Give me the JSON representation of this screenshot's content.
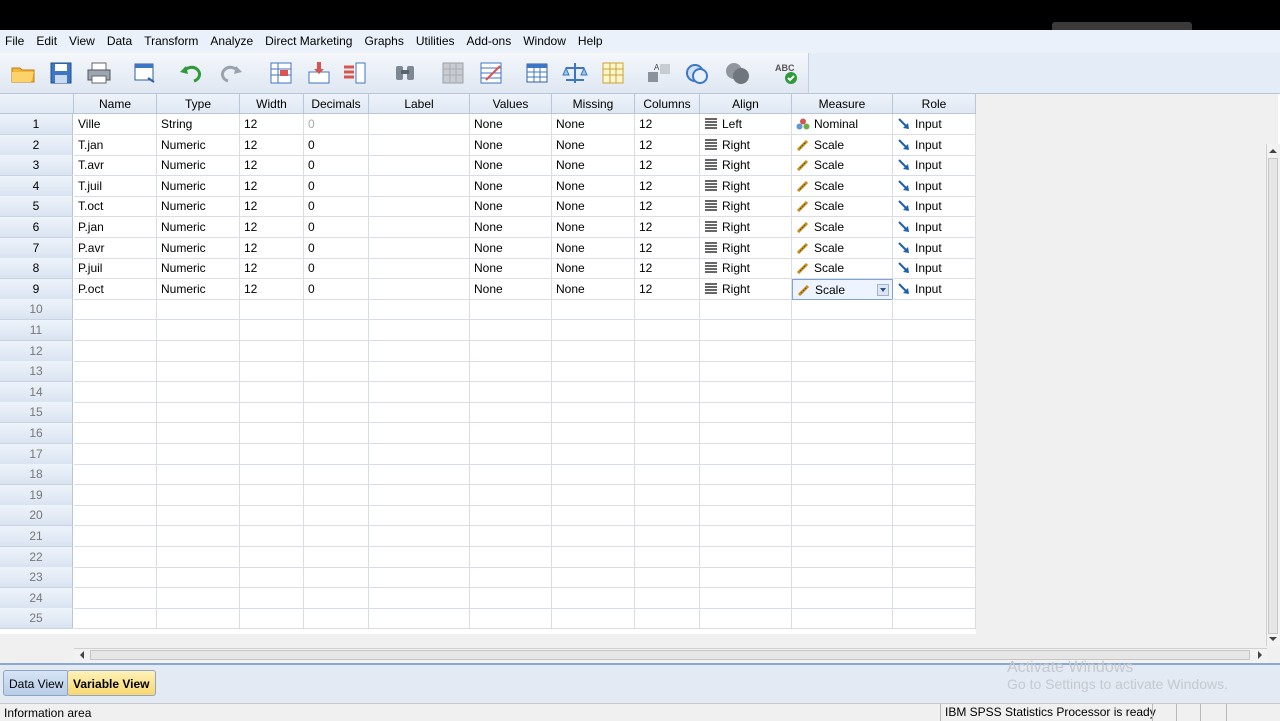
{
  "menu": [
    "File",
    "Edit",
    "View",
    "Data",
    "Transform",
    "Analyze",
    "Direct Marketing",
    "Graphs",
    "Utilities",
    "Add-ons",
    "Window",
    "Help"
  ],
  "toolbar_icons": [
    "open-folder-icon",
    "save-icon",
    "print-icon",
    "dialog-recall-icon",
    "undo-icon",
    "redo-icon",
    "goto-case-icon",
    "goto-variable-icon",
    "variables-icon",
    "find-icon",
    "split-file-icon",
    "insert-cases-icon",
    "insert-variable-icon",
    "split-icon",
    "weight-cases-icon",
    "value-labels-icon",
    "use-sets-icon",
    "show-all-icon",
    "circles-icon",
    "spellcheck-icon"
  ],
  "grid": {
    "columns": [
      "Name",
      "Type",
      "Width",
      "Decimals",
      "Label",
      "Values",
      "Missing",
      "Columns",
      "Align",
      "Measure",
      "Role"
    ],
    "rows": [
      {
        "n": "1",
        "name": "Ville",
        "type": "String",
        "width": "12",
        "decimals": "0",
        "label": "",
        "values": "None",
        "missing": "None",
        "columns": "12",
        "align": "Left",
        "measure": "Nominal",
        "role": "Input"
      },
      {
        "n": "2",
        "name": "T.jan",
        "type": "Numeric",
        "width": "12",
        "decimals": "0",
        "label": "",
        "values": "None",
        "missing": "None",
        "columns": "12",
        "align": "Right",
        "measure": "Scale",
        "role": "Input"
      },
      {
        "n": "3",
        "name": "T.avr",
        "type": "Numeric",
        "width": "12",
        "decimals": "0",
        "label": "",
        "values": "None",
        "missing": "None",
        "columns": "12",
        "align": "Right",
        "measure": "Scale",
        "role": "Input"
      },
      {
        "n": "4",
        "name": "T.juil",
        "type": "Numeric",
        "width": "12",
        "decimals": "0",
        "label": "",
        "values": "None",
        "missing": "None",
        "columns": "12",
        "align": "Right",
        "measure": "Scale",
        "role": "Input"
      },
      {
        "n": "5",
        "name": "T.oct",
        "type": "Numeric",
        "width": "12",
        "decimals": "0",
        "label": "",
        "values": "None",
        "missing": "None",
        "columns": "12",
        "align": "Right",
        "measure": "Scale",
        "role": "Input"
      },
      {
        "n": "6",
        "name": "P.jan",
        "type": "Numeric",
        "width": "12",
        "decimals": "0",
        "label": "",
        "values": "None",
        "missing": "None",
        "columns": "12",
        "align": "Right",
        "measure": "Scale",
        "role": "Input"
      },
      {
        "n": "7",
        "name": "P.avr",
        "type": "Numeric",
        "width": "12",
        "decimals": "0",
        "label": "",
        "values": "None",
        "missing": "None",
        "columns": "12",
        "align": "Right",
        "measure": "Scale",
        "role": "Input"
      },
      {
        "n": "8",
        "name": "P.juil",
        "type": "Numeric",
        "width": "12",
        "decimals": "0",
        "label": "",
        "values": "None",
        "missing": "None",
        "columns": "12",
        "align": "Right",
        "measure": "Scale",
        "role": "Input"
      },
      {
        "n": "9",
        "name": "P.oct",
        "type": "Numeric",
        "width": "12",
        "decimals": "0",
        "label": "",
        "values": "None",
        "missing": "None",
        "columns": "12",
        "align": "Right",
        "measure": "Scale",
        "role": "Input"
      }
    ],
    "empty_rows": [
      "10",
      "11",
      "12",
      "13",
      "14",
      "15",
      "16",
      "17",
      "18",
      "19",
      "20",
      "21",
      "22",
      "23",
      "24",
      "25"
    ]
  },
  "tabs": {
    "data_view": "Data View",
    "variable_view": "Variable View",
    "active": "variable_view"
  },
  "watermark": {
    "line1": "Activate Windows",
    "line2": "Go to Settings to activate Windows."
  },
  "status": {
    "left": "Information area",
    "right": "IBM SPSS Statistics Processor is ready"
  }
}
